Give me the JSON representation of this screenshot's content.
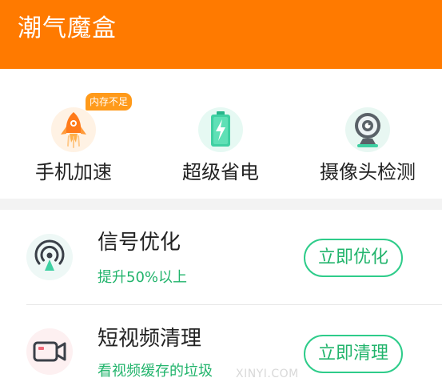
{
  "header": {
    "title": "潮气魔盒"
  },
  "tools": [
    {
      "label": "手机加速",
      "icon": "rocket-icon",
      "badge": "内存不足"
    },
    {
      "label": "超级省电",
      "icon": "battery-bolt-icon"
    },
    {
      "label": "摄像头检测",
      "icon": "webcam-icon"
    }
  ],
  "list": [
    {
      "title": "信号优化",
      "subtitle": "提升50%以上",
      "button": "立即优化",
      "icon": "signal-icon"
    },
    {
      "title": "短视频清理",
      "subtitle": "看视频缓存的垃圾",
      "button": "立即清理",
      "icon": "video-camera-icon"
    }
  ],
  "watermark": "XINYI.COM",
  "colors": {
    "header": "#ff7a00",
    "accent_green": "#22b46c",
    "badge": "#ff9a1a"
  }
}
